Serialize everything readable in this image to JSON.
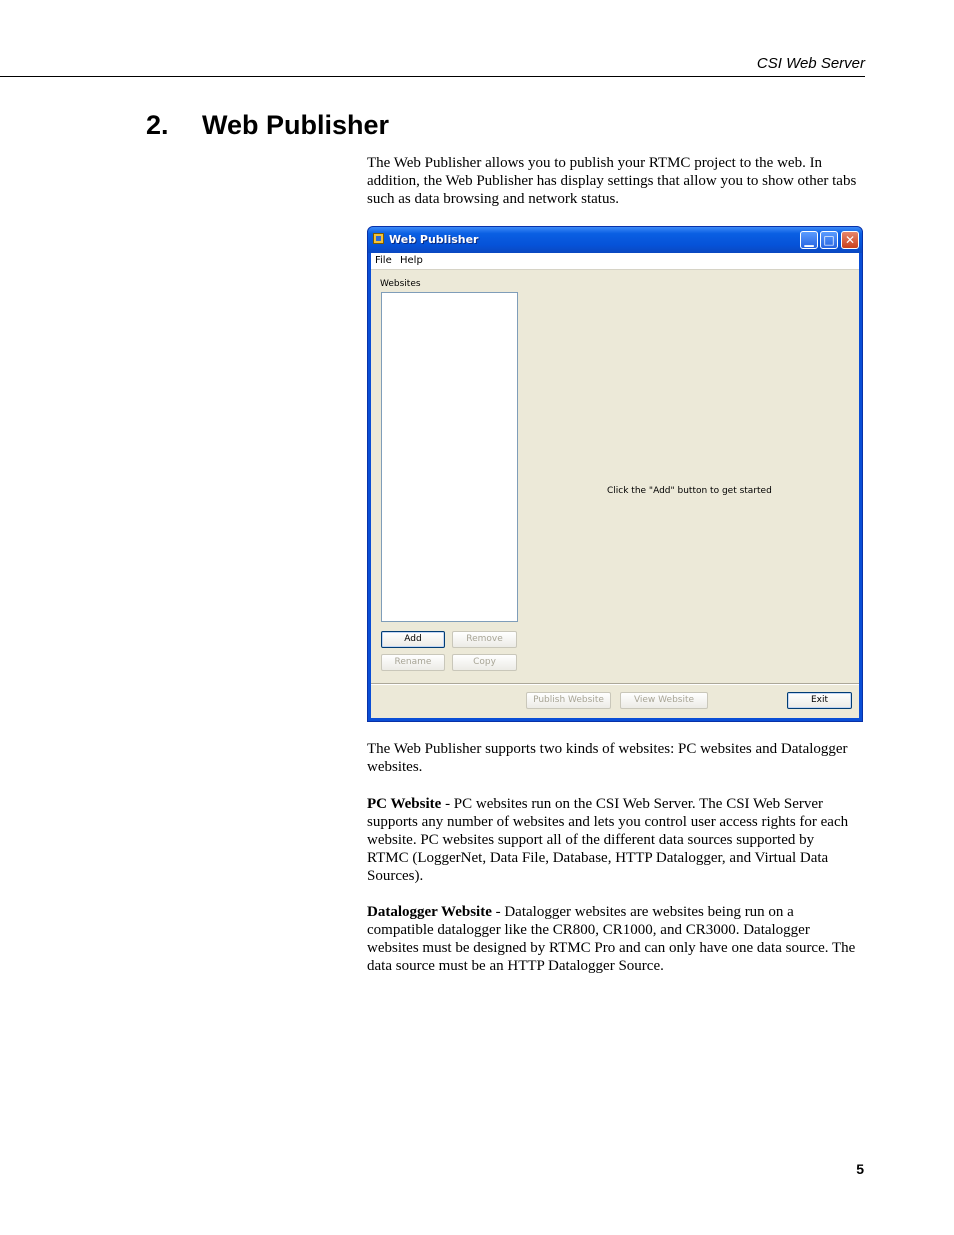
{
  "header": {
    "running_title": "CSI Web Server"
  },
  "chapter": {
    "number": "2.",
    "title": "Web Publisher"
  },
  "intro": "The Web Publisher allows you to publish your RTMC project to the web. In addition, the Web Publisher has display settings that allow you to show other tabs such as data browsing and network status.",
  "window": {
    "title": "Web Publisher",
    "menu": [
      "File",
      "Help"
    ],
    "websites_label": "Websites",
    "buttons": {
      "add": "Add",
      "remove": "Remove",
      "rename": "Rename",
      "copy": "Copy",
      "publish": "Publish Website",
      "view": "View Website",
      "exit": "Exit"
    },
    "hint": "Click the \"Add\" button to get started",
    "icons": {
      "app": "app-icon",
      "minimize": "minimize-icon",
      "maximize": "maximize-icon",
      "close": "close-icon"
    }
  },
  "kinds_para": "The Web Publisher supports two kinds of websites: PC websites and Datalogger websites.",
  "pc_website": {
    "term": "PC Website",
    "text": " - PC websites run on the CSI Web Server. The CSI Web Server supports any number of websites and lets you control user access rights for each website. PC websites support all of the different data sources supported by RTMC (LoggerNet, Data File, Database, HTTP Datalogger, and Virtual Data Sources)."
  },
  "datalogger_website": {
    "term": "Datalogger Website",
    "text": " - Datalogger websites are websites being run on a compatible datalogger like the CR800, CR1000, and CR3000. Datalogger websites must be designed by RTMC Pro and can only have one data source. The data source must be an HTTP Datalogger Source."
  },
  "footer": {
    "page_number": "5"
  }
}
